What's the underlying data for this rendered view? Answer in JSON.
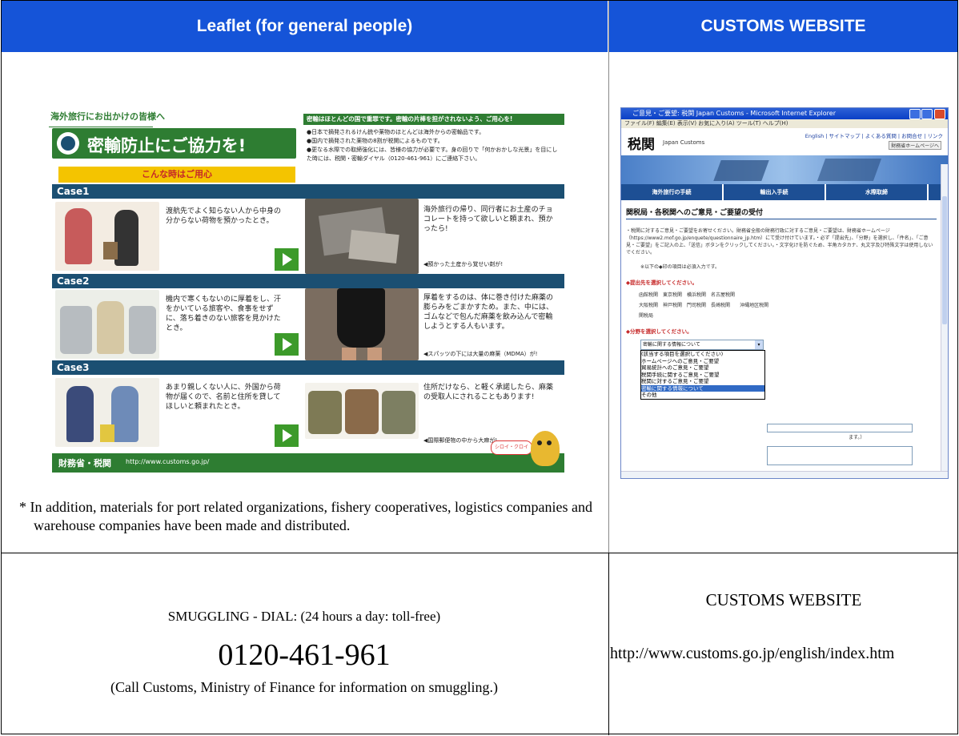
{
  "headers": {
    "left": "Leaflet (for general people)",
    "right": "CUSTOMS WEBSITE"
  },
  "leaflet": {
    "tagline": "海外旅行にお出かけの皆様へ",
    "title": "密輸防止にご協力を!",
    "subtitle": "こんな時はご用心",
    "right_banner": "密輸はほとんどの国で重罪です。密輸の片棒を担がされないよう、ご用心を!",
    "bullets": [
      "●日本で摘発されるけん銃や薬物のほとんどは海外からの密輸品です。",
      "●国内で摘発された薬物の8割が税関によるものです。",
      "●更なる水際での取締強化には、皆様の協力が必要です。身の回りで「何かおかしな光景」を目にした時には、税関・密輸ダイヤル（0120-461-961）にご連絡下さい。"
    ],
    "cases": [
      {
        "label": "Case1",
        "text": "渡航先でよく知らない人から中身の分からない荷物を預かったとき。",
        "right_text": "海外旅行の帰り、同行者にお土産のチョコレートを持って欲しいと頼まれ、預かったら!",
        "caption": "◀預かった土産から覚せい剤が!"
      },
      {
        "label": "Case2",
        "text": "機内で寒くもないのに厚着をし、汗をかいている旅客や、食事をせずに、落ち着きのない旅客を見かけたとき。",
        "right_text": "厚着をするのは、体に巻き付けた麻薬の膨らみをごまかすため。また、中には、ゴムなどで包んだ麻薬を飲み込んで密輸しようとする人もいます。",
        "caption": "◀スパッツの下には大量の麻薬（MDMA）が!"
      },
      {
        "label": "Case3",
        "text": "あまり親しくない人に、外国から荷物が届くので、名前と住所を貸してほしいと頼まれたとき。",
        "right_text": "住所だけなら、と軽く承諾したら、麻薬の受取人にされることもあります!",
        "caption": "◀国際郵便物の中から大麻が!"
      }
    ],
    "mascot_label": "シロイ・クロイ",
    "footer_org": "財務省・税関",
    "footer_url": "http://www.customs.go.jp/"
  },
  "note": "* In addition, materials for port related organizations, fishery cooperatives, logistics companies and warehouse companies have been made and distributed.",
  "browser": {
    "title": "ご意見・ご要望: 税関 Japan Customs - Microsoft Internet Explorer",
    "menu": "ファイル(F)  編集(E)  表示(V)  お気に入り(A)  ツール(T)  ヘルプ(H)",
    "logo": "税関",
    "logo_sub": "Japan Customs",
    "toplinks": "English | サイトマップ | よくある質問 | お問合せ | リンク",
    "mof_link": "財務省ホームページへ",
    "nav": [
      "海外旅行の手続",
      "輸出入手続",
      "水際取締"
    ],
    "heading": "関税局・各税関へのご意見・ご要望の受付",
    "para": "・税関に対するご意見・ご要望をお寄せください。財務省全般の財務行政に対するご意見・ご要望は、財務省ホームページ（https://www2.mof.go.jp/enquete/questionnaire_jp.htm）にて受け付けています。・必ず「提出先」、「分野」を選択し、「件名」、「ご意見・ご要望」をご記入の上、「送信」ボタンをクリックしてください。・文字化けを防ぐため、半角カタカナ、丸文字及び特殊文字は使用しないでください。",
    "required_note": "※以下の◆印の項目は必須入力です。",
    "dest_label": "◆提出先を選択してください。",
    "dest_options": [
      "函館税関",
      "東京税関",
      "横浜税関",
      "名古屋税関",
      "大阪税関",
      "神戸税関",
      "門司税関",
      "長崎税関",
      "沖縄地区税関",
      "関税局"
    ],
    "field_label": "◆分野を選択してください。",
    "select_value": "密輸に関する情報について",
    "select_options": [
      "(該当する項目を選択してください)",
      "ホームページへのご意見・ご要望",
      "貿易統計へのご意見・ご要望",
      "税関手続に関するご意見・ご要望",
      "税関に対するご意見・ご要望",
      "密輸に関する情報について",
      "その他"
    ],
    "partial_text": "ます。）"
  },
  "footer": {
    "dial_label": "SMUGGLING - DIAL: (24 hours a day: toll-free)",
    "phone": "0120-461-961",
    "dial_note": "(Call Customs, Ministry of Finance for information on smuggling.)",
    "website_label": "CUSTOMS WEBSITE",
    "website_url": "http://www.customs.go.jp/english/index.htm"
  },
  "colors": {
    "header_blue": "#1554d8",
    "case_bar": "#1b4f72",
    "leaflet_green": "#2e7d32",
    "leaflet_yellow": "#f4c400"
  }
}
